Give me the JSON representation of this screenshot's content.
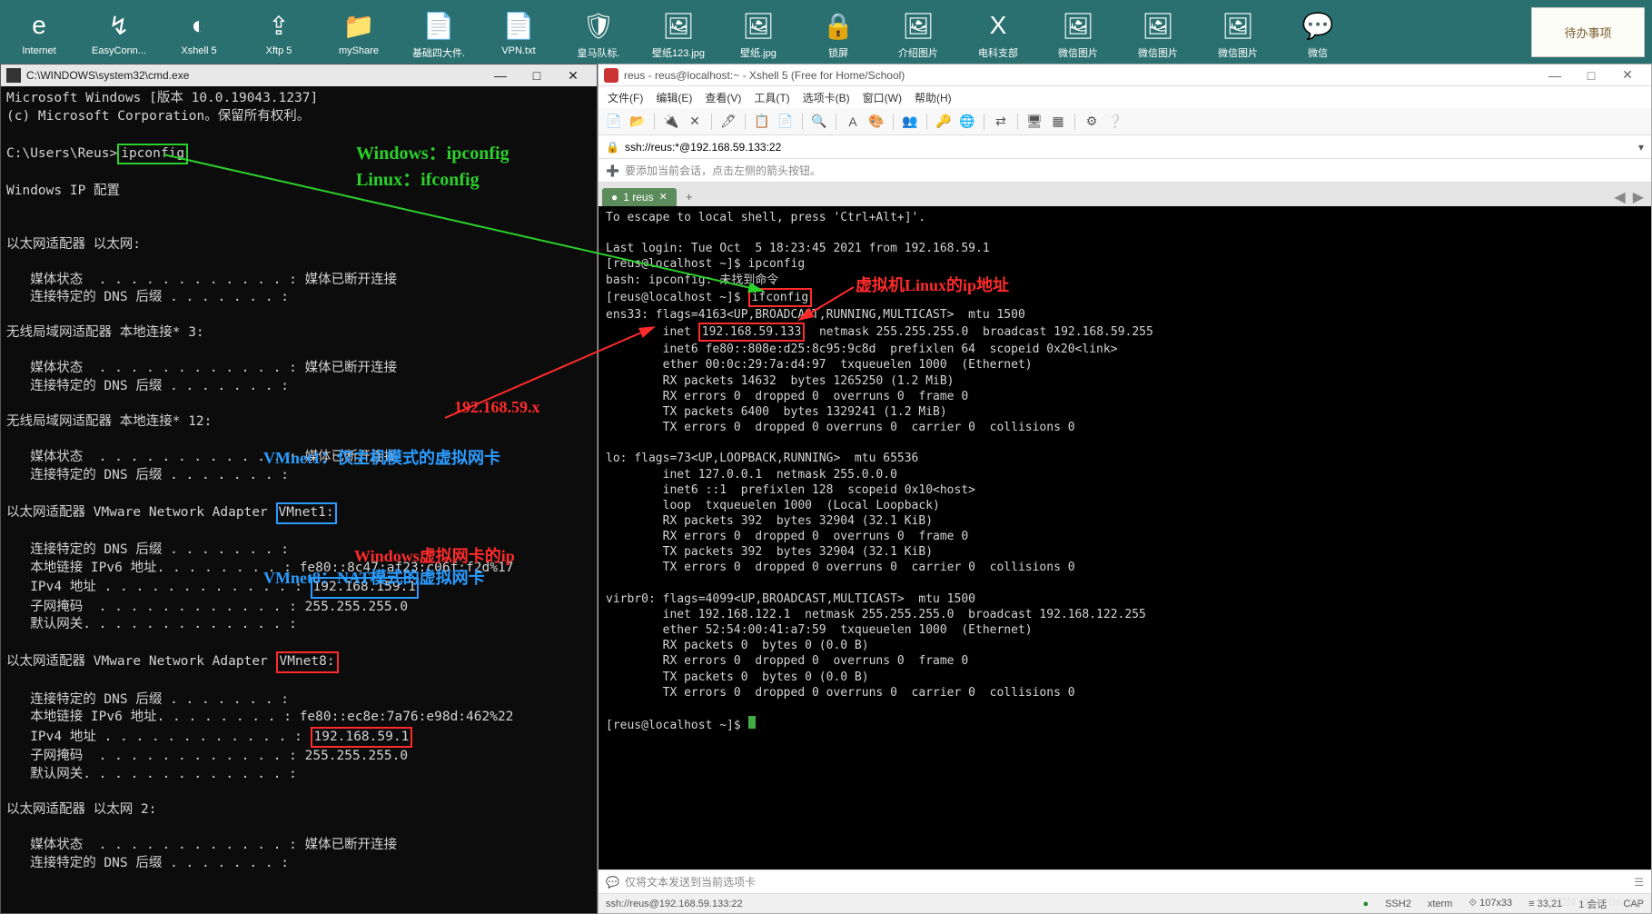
{
  "sticky": {
    "label": "待办事项"
  },
  "desktop_icons": [
    {
      "label": "Internet",
      "glyph": "e"
    },
    {
      "label": "EasyConn...",
      "glyph": "↯"
    },
    {
      "label": "Xshell 5",
      "glyph": "◐"
    },
    {
      "label": "Xftp 5",
      "glyph": "⇪"
    },
    {
      "label": "myShare",
      "glyph": "📁"
    },
    {
      "label": "基础四大件.",
      "glyph": "📄"
    },
    {
      "label": "VPN.txt",
      "glyph": "📄"
    },
    {
      "label": "皇马队标.",
      "glyph": "🛡"
    },
    {
      "label": "壁纸123.jpg",
      "glyph": "🖼"
    },
    {
      "label": "壁纸.jpg",
      "glyph": "🖼"
    },
    {
      "label": "锁屏",
      "glyph": "🔒"
    },
    {
      "label": "介绍图片",
      "glyph": "🖼"
    },
    {
      "label": "电科支部",
      "glyph": "X"
    },
    {
      "label": "微信图片",
      "glyph": "🖼"
    },
    {
      "label": "微信图片",
      "glyph": "🖼"
    },
    {
      "label": "微信图片",
      "glyph": "🖼"
    },
    {
      "label": "微信",
      "glyph": "💬"
    }
  ],
  "cmd": {
    "title": "C:\\WINDOWS\\system32\\cmd.exe",
    "win_btns": {
      "min": "—",
      "max": "□",
      "close": "✕"
    },
    "lines": {
      "l1": "Microsoft Windows [版本 10.0.19043.1237]",
      "l2": "(c) Microsoft Corporation。保留所有权利。",
      "l3a": "C:\\Users\\Reus>",
      "l3b": "ipconfig",
      "l4": "Windows IP 配置",
      "sec1": "以太网适配器 以太网:",
      "sec1_a": "   媒体状态  . . . . . . . . . . . . : 媒体已断开连接",
      "sec1_b": "   连接特定的 DNS 后缀 . . . . . . . :",
      "sec2": "无线局域网适配器 本地连接* 3:",
      "sec3": "无线局域网适配器 本地连接* 12:",
      "sec4": "以太网适配器 VMware Network Adapter ",
      "sec4b": "VMnet1:",
      "sec4_a": "   连接特定的 DNS 后缀 . . . . . . . :",
      "sec4_b": "   本地链接 IPv6 地址. . . . . . . . : fe80::8c47:af23:c06f:f2d%17",
      "sec4_c": "   IPv4 地址 . . . . . . . . . . . . : ",
      "sec4_c2": "192.168.159.1",
      "sec4_d": "   子网掩码  . . . . . . . . . . . . : 255.255.255.0",
      "sec4_e": "   默认网关. . . . . . . . . . . . . :",
      "sec5": "以太网适配器 VMware Network Adapter ",
      "sec5b": "VMnet8:",
      "sec5_b": "   本地链接 IPv6 地址. . . . . . . . : fe80::ec8e:7a76:e98d:462%22",
      "sec5_c": "   IPv4 地址 . . . . . . . . . . . . : ",
      "sec5_c2": "192.168.59.1",
      "sec5_d": "   子网掩码  . . . . . . . . . . . . : 255.255.255.0",
      "sec6": "以太网适配器 以太网 2:"
    }
  },
  "xshell": {
    "title": "reus - reus@localhost:~ - Xshell 5 (Free for Home/School)",
    "win_btns": {
      "min": "—",
      "max": "□",
      "close": "✕"
    },
    "menu": [
      "文件(F)",
      "编辑(E)",
      "查看(V)",
      "工具(T)",
      "选项卡(B)",
      "窗口(W)",
      "帮助(H)"
    ],
    "addr": "ssh://reus:*@192.168.59.133:22",
    "hint": "要添加当前会话，点击左侧的箭头按钮。",
    "tab": "1 reus",
    "term": {
      "l1": "To escape to local shell, press 'Ctrl+Alt+]'.",
      "l2": "Last login: Tue Oct  5 18:23:45 2021 from 192.168.59.1",
      "l3": "[reus@localhost ~]$ ipconfig",
      "l4": "bash: ipconfig: 未找到命令",
      "l5a": "[reus@localhost ~]$ ",
      "l5b": "ifconfig",
      "e1": "ens33: flags=4163<UP,BROADCAST,RUNNING,MULTICAST>  mtu 1500",
      "e2a": "        inet ",
      "e2b": "192.168.59.133",
      "e2c": "  netmask 255.255.255.0  broadcast 192.168.59.255",
      "e3": "        inet6 fe80::808e:d25:8c95:9c8d  prefixlen 64  scopeid 0x20<link>",
      "e4": "        ether 00:0c:29:7a:d4:97  txqueuelen 1000  (Ethernet)",
      "e5": "        RX packets 14632  bytes 1265250 (1.2 MiB)",
      "e6": "        RX errors 0  dropped 0  overruns 0  frame 0",
      "e7": "        TX packets 6400  bytes 1329241 (1.2 MiB)",
      "e8": "        TX errors 0  dropped 0 overruns 0  carrier 0  collisions 0",
      "lo1": "lo: flags=73<UP,LOOPBACK,RUNNING>  mtu 65536",
      "lo2": "        inet 127.0.0.1  netmask 255.0.0.0",
      "lo3": "        inet6 ::1  prefixlen 128  scopeid 0x10<host>",
      "lo4": "        loop  txqueuelen 1000  (Local Loopback)",
      "lo5": "        RX packets 392  bytes 32904 (32.1 KiB)",
      "lo6": "        RX errors 0  dropped 0  overruns 0  frame 0",
      "lo7": "        TX packets 392  bytes 32904 (32.1 KiB)",
      "lo8": "        TX errors 0  dropped 0 overruns 0  carrier 0  collisions 0",
      "vb1": "virbr0: flags=4099<UP,BROADCAST,MULTICAST>  mtu 1500",
      "vb2": "        inet 192.168.122.1  netmask 255.255.255.0  broadcast 192.168.122.255",
      "vb3": "        ether 52:54:00:41:a7:59  txqueuelen 1000  (Ethernet)",
      "vb4": "        RX packets 0  bytes 0 (0.0 B)",
      "vb5": "        RX errors 0  dropped 0  overruns 0  frame 0",
      "vb6": "        TX packets 0  bytes 0 (0.0 B)",
      "vb7": "        TX errors 0  dropped 0 overruns 0  carrier 0  collisions 0",
      "prompt": "[reus@localhost ~]$ "
    },
    "input_hint": "仅将文本发送到当前选项卡",
    "status": {
      "conn": "ssh://reus@192.168.59.133:22",
      "ssh": "SSH2",
      "term": "xterm",
      "size": "107x33",
      "pos": "33,21",
      "sess": "1 会话",
      "cap": "CAP"
    }
  },
  "annotations": {
    "top_cmds": "Windows：ipconfig\nLinux：ifconfig",
    "vmnet1": "VMnet1：仅主机模式的虚拟网卡",
    "subnet": "192.168.59.x",
    "vmnet8_a": "Windows虚拟网卡的ip",
    "vmnet8_b": "VMnet8：NAT模式的虚拟网卡",
    "linux_ip": "虚拟机Linux的ip地址"
  },
  "watermark": "CSDN @Reus_try"
}
